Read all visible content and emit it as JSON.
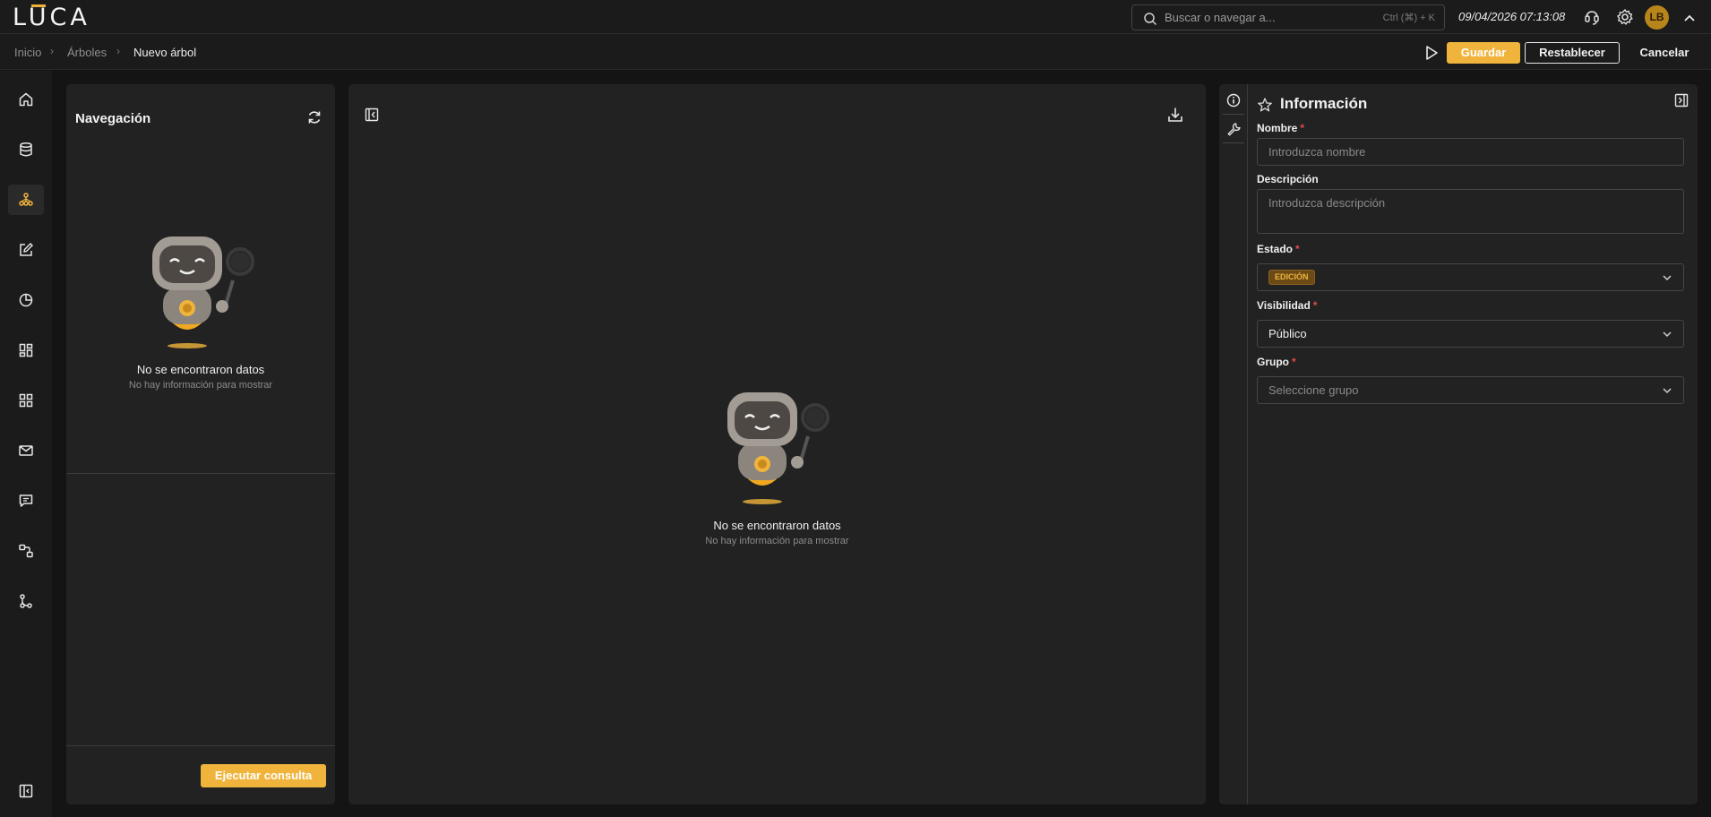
{
  "app": {
    "logo": "LUCA"
  },
  "header": {
    "search_placeholder": "Buscar o navegar a...",
    "search_shortcut": "Ctrl (⌘) + K",
    "datetime": "09/04/2026 07:13:08",
    "avatar_initials": "LB"
  },
  "breadcrumb": {
    "items": [
      "Inicio",
      "Árboles",
      "Nuevo árbol"
    ]
  },
  "actions": {
    "save": "Guardar",
    "reset": "Restablecer",
    "cancel": "Cancelar"
  },
  "sidebar": {
    "items": [
      {
        "icon": "home-icon"
      },
      {
        "icon": "database-icon"
      },
      {
        "icon": "tree-icon",
        "active": true
      },
      {
        "icon": "edit-icon"
      },
      {
        "icon": "pie-chart-icon"
      },
      {
        "icon": "dashboard-icon"
      },
      {
        "icon": "widgets-icon"
      },
      {
        "icon": "mail-icon"
      },
      {
        "icon": "comment-icon"
      },
      {
        "icon": "workflow-icon"
      },
      {
        "icon": "branch-icon"
      }
    ],
    "collapse_icon": "collapse-sidebar-icon"
  },
  "navigation_panel": {
    "title": "Navegación",
    "empty_title": "No se encontraron datos",
    "empty_subtitle": "No hay información para mostrar",
    "run_button": "Ejecutar consulta"
  },
  "canvas_panel": {
    "empty_title": "No se encontraron datos",
    "empty_subtitle": "No hay información para mostrar"
  },
  "info_panel": {
    "title": "Información",
    "fields": {
      "name": {
        "label": "Nombre",
        "placeholder": "Introduzca nombre"
      },
      "description": {
        "label": "Descripción",
        "placeholder": "Introduzca descripción"
      },
      "status": {
        "label": "Estado",
        "value": "EDICIÓN"
      },
      "visibility": {
        "label": "Visibilidad",
        "value": "Público"
      },
      "group": {
        "label": "Grupo",
        "placeholder": "Seleccione grupo"
      }
    },
    "required_mark": "*"
  },
  "colors": {
    "accent": "#f0b43c",
    "background": "#141414",
    "panel": "#222222",
    "required": "#e14b4b"
  }
}
